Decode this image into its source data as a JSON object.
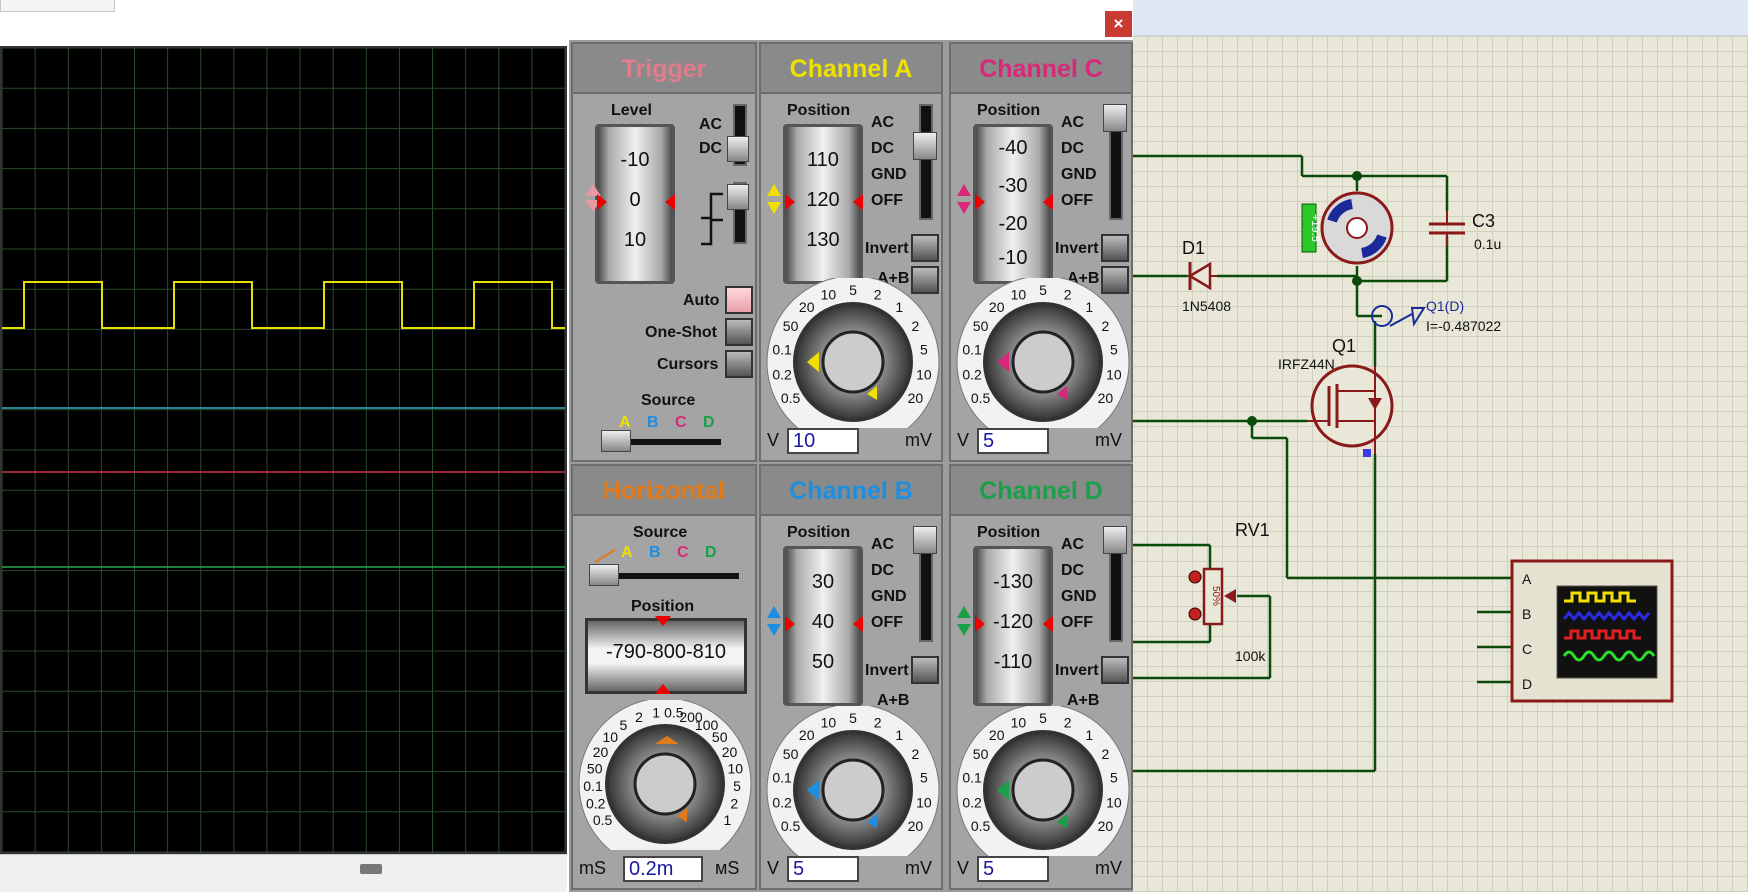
{
  "window": {
    "close_label": "×"
  },
  "scope": {
    "grid_color": "#2b4a2b",
    "trace_a_color": "#e8e000",
    "trace_b_color": "#2fb0c8",
    "trace_c_color": "#d0304a",
    "trace_d_color": "#2aa84a"
  },
  "trigger": {
    "title": "Trigger",
    "title_color": "#e07c8c",
    "level_label": "Level",
    "level_ticks": [
      "-10",
      "0",
      "10"
    ],
    "coupling": [
      "AC",
      "DC"
    ],
    "auto_label": "Auto",
    "oneshot_label": "One-Shot",
    "cursors_label": "Cursors",
    "source_label": "Source",
    "source_channels": [
      "A",
      "B",
      "C",
      "D"
    ]
  },
  "horizontal": {
    "title": "Horizontal",
    "title_color": "#e07a1a",
    "source_label": "Source",
    "source_channels": [
      "A",
      "B",
      "C",
      "D"
    ],
    "position_label": "Position",
    "position_ticks": "-790-800-810",
    "dial_ticks": [
      "0.5",
      "0.2",
      "0.1",
      "50",
      "20",
      "10",
      "5",
      "2",
      "1",
      "0.5",
      "200",
      "100",
      "50",
      "20",
      "10",
      "5",
      "2",
      "1"
    ],
    "unit_left": "mS",
    "unit_right": "мS",
    "timebase_value": "0.2m"
  },
  "channels": [
    {
      "id": "a",
      "title": "Channel A",
      "color": "#f0e000",
      "position_label": "Position",
      "ticks": [
        "110",
        "120",
        "130"
      ],
      "coupling": [
        "AC",
        "DC",
        "GND",
        "OFF"
      ],
      "invert_label": "Invert",
      "apb_label": "A+B",
      "unit_left": "V",
      "unit_right": "mV",
      "volts_value": "10"
    },
    {
      "id": "c",
      "title": "Channel C",
      "color": "#d8287a",
      "position_label": "Position",
      "ticks": [
        "-40",
        "-30",
        "-20",
        "-10"
      ],
      "coupling": [
        "AC",
        "DC",
        "GND",
        "OFF"
      ],
      "invert_label": "Invert",
      "apb_label": "A+B",
      "unit_left": "V",
      "unit_right": "mV",
      "volts_value": "5"
    },
    {
      "id": "b",
      "title": "Channel B",
      "color": "#1e8ee0",
      "position_label": "Position",
      "ticks": [
        "30",
        "40",
        "50"
      ],
      "coupling": [
        "AC",
        "DC",
        "GND",
        "OFF"
      ],
      "invert_label": "Invert",
      "apb_label": "A+B",
      "unit_left": "V",
      "unit_right": "mV",
      "volts_value": "5"
    },
    {
      "id": "d",
      "title": "Channel D",
      "color": "#1aa048",
      "position_label": "Position",
      "ticks": [
        "-130",
        "-120",
        "-110"
      ],
      "coupling": [
        "AC",
        "DC",
        "GND",
        "OFF"
      ],
      "invert_label": "Invert",
      "apb_label": "A+B",
      "unit_left": "V",
      "unit_right": "mV",
      "volts_value": "5"
    }
  ],
  "dial_labels": [
    "0.5",
    "0.2",
    "0.1",
    "50",
    "20",
    "10",
    "5",
    "2",
    "1",
    "2",
    "5",
    "10",
    "20"
  ],
  "schematic": {
    "motor_label": "+19.5",
    "c3_label": "C3",
    "c3_value": "0.1u",
    "d1_label": "D1",
    "d1_value": "1N5408",
    "q1_label": "Q1",
    "q1_value": "IRFZ44N",
    "probe_label": "Q1(D)",
    "probe_value": "I=-0.487022",
    "rv1_label": "RV1",
    "rv1_value": "100k",
    "rv1_pct": "50%",
    "scope_pins": [
      "A",
      "B",
      "C",
      "D"
    ]
  }
}
